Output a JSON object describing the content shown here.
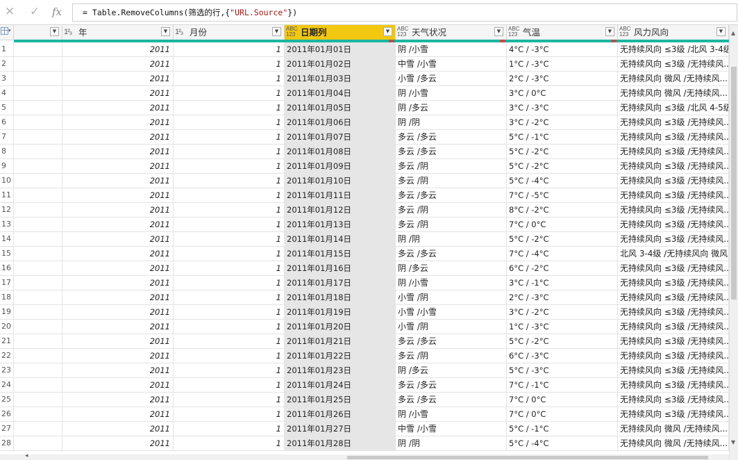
{
  "formula_bar": {
    "cancel_icon": "close-icon",
    "commit_icon": "check-icon",
    "fx_label": "fx",
    "formula_prefix": "= Table.RemoveColumns(筛选的行,{",
    "formula_string": "\"URL.Source\"",
    "formula_suffix": "})"
  },
  "columns": [
    {
      "name": "",
      "type": ""
    },
    {
      "name": "年",
      "type": "123"
    },
    {
      "name": "月份",
      "type": "123"
    },
    {
      "name": "日期列",
      "type": "ABC"
    },
    {
      "name": "天气状况",
      "type": "ABC"
    },
    {
      "name": "气温",
      "type": "ABC"
    },
    {
      "name": "风力风向",
      "type": "ABC"
    }
  ],
  "type_labels": {
    "num": "1²₃",
    "abc_top": "ABC",
    "abc_bottom": "123"
  },
  "accent_color": "#f2c811",
  "quality_color": "#1cb5a0",
  "rows": [
    {
      "n": "1",
      "year": "2011",
      "month": "1",
      "date": "2011年01月01日",
      "weather": "阴 /小雪",
      "temp": "4°C / -3°C",
      "wind": "无持续风向 ≤3级 /北风 3-4级"
    },
    {
      "n": "2",
      "year": "2011",
      "month": "1",
      "date": "2011年01月02日",
      "weather": "中雪 /小雪",
      "temp": "1°C / -3°C",
      "wind": "无持续风向 ≤3级 /无持续风..."
    },
    {
      "n": "3",
      "year": "2011",
      "month": "1",
      "date": "2011年01月03日",
      "weather": "小雪 /多云",
      "temp": "2°C / -3°C",
      "wind": "无持续风向 微风 /无持续风..."
    },
    {
      "n": "4",
      "year": "2011",
      "month": "1",
      "date": "2011年01月04日",
      "weather": "阴 /小雪",
      "temp": "3°C / 0°C",
      "wind": "无持续风向 微风 /无持续风..."
    },
    {
      "n": "5",
      "year": "2011",
      "month": "1",
      "date": "2011年01月05日",
      "weather": "阴 /多云",
      "temp": "3°C / -3°C",
      "wind": "无持续风向 ≤3级 /北风 4-5级"
    },
    {
      "n": "6",
      "year": "2011",
      "month": "1",
      "date": "2011年01月06日",
      "weather": "阴 /阴",
      "temp": "3°C / -2°C",
      "wind": "无持续风向 ≤3级 /无持续风..."
    },
    {
      "n": "7",
      "year": "2011",
      "month": "1",
      "date": "2011年01月07日",
      "weather": "多云 /多云",
      "temp": "5°C / -1°C",
      "wind": "无持续风向 ≤3级 /无持续风..."
    },
    {
      "n": "8",
      "year": "2011",
      "month": "1",
      "date": "2011年01月08日",
      "weather": "多云 /多云",
      "temp": "5°C / -2°C",
      "wind": "无持续风向 ≤3级 /无持续风..."
    },
    {
      "n": "9",
      "year": "2011",
      "month": "1",
      "date": "2011年01月09日",
      "weather": "多云 /阴",
      "temp": "5°C / -2°C",
      "wind": "无持续风向 ≤3级 /无持续风..."
    },
    {
      "n": "10",
      "year": "2011",
      "month": "1",
      "date": "2011年01月10日",
      "weather": "多云 /阴",
      "temp": "5°C / -4°C",
      "wind": "无持续风向 ≤3级 /无持续风..."
    },
    {
      "n": "11",
      "year": "2011",
      "month": "1",
      "date": "2011年01月11日",
      "weather": "多云 /多云",
      "temp": "7°C / -5°C",
      "wind": "无持续风向 ≤3级 /无持续风..."
    },
    {
      "n": "12",
      "year": "2011",
      "month": "1",
      "date": "2011年01月12日",
      "weather": "多云 /阴",
      "temp": "8°C / -2°C",
      "wind": "无持续风向 ≤3级 /无持续风..."
    },
    {
      "n": "13",
      "year": "2011",
      "month": "1",
      "date": "2011年01月13日",
      "weather": "多云 /阴",
      "temp": "7°C / 0°C",
      "wind": "无持续风向 ≤3级 /无持续风..."
    },
    {
      "n": "14",
      "year": "2011",
      "month": "1",
      "date": "2011年01月14日",
      "weather": "阴 /阴",
      "temp": "5°C / -2°C",
      "wind": "无持续风向 ≤3级 /无持续风..."
    },
    {
      "n": "15",
      "year": "2011",
      "month": "1",
      "date": "2011年01月15日",
      "weather": "多云 /多云",
      "temp": "7°C / -4°C",
      "wind": "北风 3-4级 /无持续风向 微风"
    },
    {
      "n": "16",
      "year": "2011",
      "month": "1",
      "date": "2011年01月16日",
      "weather": "阴 /多云",
      "temp": "6°C / -2°C",
      "wind": "无持续风向 ≤3级 /无持续风..."
    },
    {
      "n": "17",
      "year": "2011",
      "month": "1",
      "date": "2011年01月17日",
      "weather": "阴 /小雪",
      "temp": "3°C / -1°C",
      "wind": "无持续风向 ≤3级 /无持续风..."
    },
    {
      "n": "18",
      "year": "2011",
      "month": "1",
      "date": "2011年01月18日",
      "weather": "小雪 /阴",
      "temp": "2°C / -3°C",
      "wind": "无持续风向 ≤3级 /无持续风..."
    },
    {
      "n": "19",
      "year": "2011",
      "month": "1",
      "date": "2011年01月19日",
      "weather": "小雪 /小雪",
      "temp": "3°C / -2°C",
      "wind": "无持续风向 ≤3级 /无持续风..."
    },
    {
      "n": "20",
      "year": "2011",
      "month": "1",
      "date": "2011年01月20日",
      "weather": "小雪 /阴",
      "temp": "1°C / -3°C",
      "wind": "无持续风向 ≤3级 /无持续风..."
    },
    {
      "n": "21",
      "year": "2011",
      "month": "1",
      "date": "2011年01月21日",
      "weather": "多云 /多云",
      "temp": "5°C / -2°C",
      "wind": "无持续风向 ≤3级 /无持续风..."
    },
    {
      "n": "22",
      "year": "2011",
      "month": "1",
      "date": "2011年01月22日",
      "weather": "多云 /阴",
      "temp": "6°C / -3°C",
      "wind": "无持续风向 ≤3级 /无持续风..."
    },
    {
      "n": "23",
      "year": "2011",
      "month": "1",
      "date": "2011年01月23日",
      "weather": "阴 /多云",
      "temp": "5°C / -3°C",
      "wind": "无持续风向 ≤3级 /无持续风..."
    },
    {
      "n": "24",
      "year": "2011",
      "month": "1",
      "date": "2011年01月24日",
      "weather": "多云 /多云",
      "temp": "7°C / -1°C",
      "wind": "无持续风向 ≤3级 /无持续风..."
    },
    {
      "n": "25",
      "year": "2011",
      "month": "1",
      "date": "2011年01月25日",
      "weather": "多云 /多云",
      "temp": "7°C / 0°C",
      "wind": "无持续风向 ≤3级 /无持续风..."
    },
    {
      "n": "26",
      "year": "2011",
      "month": "1",
      "date": "2011年01月26日",
      "weather": "阴 /小雪",
      "temp": "7°C / 0°C",
      "wind": "无持续风向 ≤3级 /无持续风..."
    },
    {
      "n": "27",
      "year": "2011",
      "month": "1",
      "date": "2011年01月27日",
      "weather": "中雪 /小雪",
      "temp": "5°C / -1°C",
      "wind": "无持续风向 微风 /无持续风..."
    },
    {
      "n": "28",
      "year": "2011",
      "month": "1",
      "date": "2011年01月28日",
      "weather": "阴 /阴",
      "temp": "5°C / -4°C",
      "wind": "无持续风向 微风 /无持续风..."
    }
  ]
}
